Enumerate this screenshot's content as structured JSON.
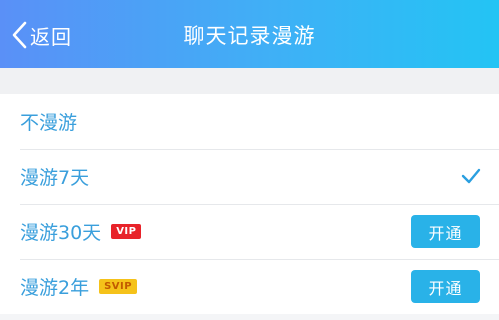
{
  "header": {
    "back_label": "返回",
    "title": "聊天记录漫游"
  },
  "options": [
    {
      "label": "不漫游",
      "badge": "",
      "selected": false,
      "action_label": ""
    },
    {
      "label": "漫游7天",
      "badge": "",
      "selected": true,
      "action_label": ""
    },
    {
      "label": "漫游30天",
      "badge": "VIP",
      "selected": false,
      "action_label": "开通"
    },
    {
      "label": "漫游2年",
      "badge": "SVIP",
      "selected": false,
      "action_label": "开通"
    }
  ],
  "colors": {
    "header_start": "#5a90f7",
    "header_end": "#23c4f4",
    "label_text": "#3a9fdc",
    "checkmark": "#2a9fe0",
    "button": "#29b2e8",
    "vip_badge": "#e8232a",
    "svip_badge": "#f5c21a"
  },
  "icons": {
    "back": "chevron-left-icon",
    "selected": "checkmark-icon"
  }
}
